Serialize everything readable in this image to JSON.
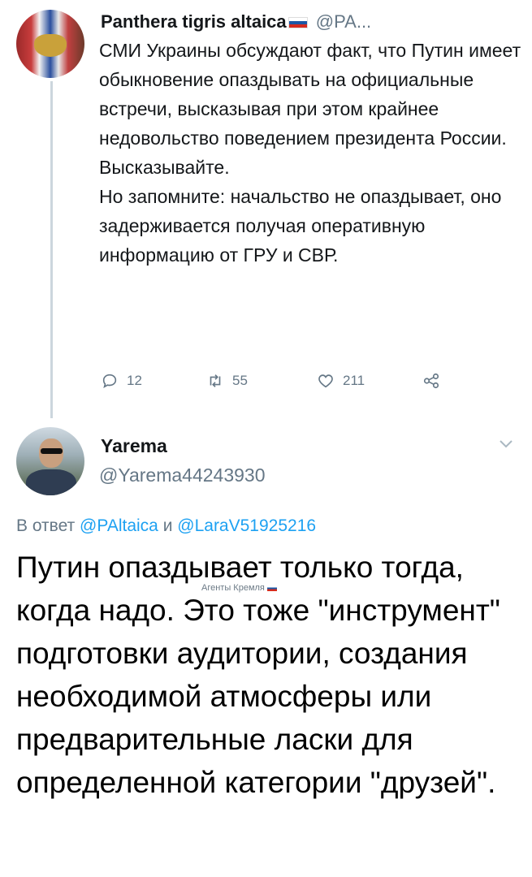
{
  "tweet1": {
    "author_name": "Panthera tigris altaica",
    "author_handle": "@PA...",
    "paragraphs": [
      "СМИ Украины обсуждают факт, что Путин имеет обыкновение опаздывать на официальные встречи, высказывая при этом крайнее недовольство поведением президента России.",
      "Высказывайте.",
      "Но запомните: начальство не опаздывает, оно задерживается получая оперативную информацию от ГРУ и СВР."
    ],
    "stats": {
      "replies": "12",
      "retweets": "55",
      "likes": "211"
    }
  },
  "tweet2": {
    "author_name": "Yarema",
    "author_handle": "@Yarema44243930",
    "reply_prefix": "В ответ",
    "reply_mention_1": "@PAltaica",
    "reply_conjunction": "и",
    "reply_mention_2": "@LaraV51925216",
    "text": "Путин опаздывает только тогда, когда надо. Это тоже \"инструмент\" подготовки аудитории, создания необходимой атмосферы или предварительные ласки для определенной категории \"друзей\"."
  },
  "watermark": "Агенты Кремля",
  "icons": {
    "reply": "reply-icon",
    "retweet": "retweet-icon",
    "like": "heart-icon",
    "share": "share-icon",
    "more": "chevron-down-icon"
  },
  "colors": {
    "link": "#1da1f2",
    "muted": "#657786",
    "thread": "#ccd6dd"
  }
}
